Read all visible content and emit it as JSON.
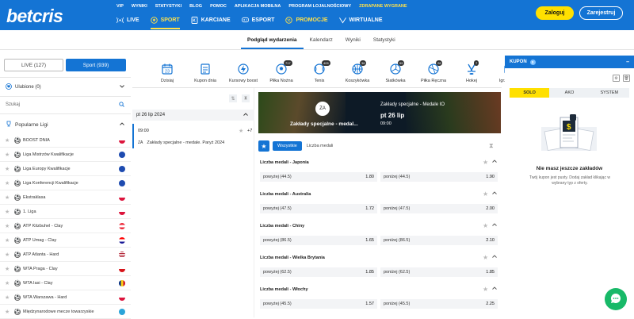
{
  "brand": {
    "logo": "betcris"
  },
  "top_links": [
    "VIP",
    "WYNIKI",
    "STATYSTYKI",
    "BLOG",
    "POMOC",
    "APLIKACJA MOBILNA",
    "PROGRAM LOJALNOŚCIOWY",
    "ZDRAPANE WYGRANE"
  ],
  "main_nav": [
    {
      "label": "LIVE",
      "icon": "live-icon"
    },
    {
      "label": "SPORT",
      "icon": "sport-icon"
    },
    {
      "label": "KARCIANE",
      "icon": "cards-icon"
    },
    {
      "label": "ESPORT",
      "icon": "esport-icon"
    },
    {
      "label": "PROMOCJE",
      "icon": "promo-icon"
    },
    {
      "label": "WIRTUALNE",
      "icon": "virtual-icon"
    }
  ],
  "auth": {
    "login": "Zaloguj",
    "register": "Zarejestruj"
  },
  "sub_tabs": [
    "Podgląd wydarzenia",
    "Kalendarz",
    "Wyniki",
    "Statystyki"
  ],
  "left": {
    "live_btn": "LIVE (127)",
    "sport_btn": "Sport (939)",
    "favorites": "Ulubione (0)",
    "search_placeholder": "Szukaj",
    "popular": "Popularne Ligi",
    "leagues": [
      {
        "name": "BOOST DNIA",
        "flag": "pl"
      },
      {
        "name": "Liga Mistrzów Kwalifikacje",
        "flag": "eu"
      },
      {
        "name": "Liga Europy Kwalifikacje",
        "flag": "eu"
      },
      {
        "name": "Liga Konferencji Kwalifikacje",
        "flag": "eu"
      },
      {
        "name": "Ekstraklasa",
        "flag": "pl"
      },
      {
        "name": "1. Liga",
        "flag": "pl"
      },
      {
        "name": "ATP Kitzbuhel - Clay",
        "flag": "at"
      },
      {
        "name": "ATP Umag - Clay",
        "flag": "hr"
      },
      {
        "name": "ATP Atlanta - Hard",
        "flag": "us"
      },
      {
        "name": "WTA Praga - Clay",
        "flag": "cz"
      },
      {
        "name": "WTA Iasi - Clay",
        "flag": "ro"
      },
      {
        "name": "WTA Warszawa - Hard",
        "flag": "pl"
      },
      {
        "name": "Międzynarodowe mecze towarzyskie",
        "flag": "world"
      }
    ]
  },
  "sports": [
    {
      "label": "Dzisiaj",
      "icon": "calendar-icon"
    },
    {
      "label": "Kupon dnia",
      "icon": "coupon-icon"
    },
    {
      "label": "Kursowy boost",
      "icon": "boost-icon"
    },
    {
      "label": "Piłka Nożna",
      "icon": "football-icon",
      "count": "717"
    },
    {
      "label": "Tenis",
      "icon": "tennis-icon",
      "count": "405"
    },
    {
      "label": "Koszykówka",
      "icon": "basketball-icon",
      "count": "36"
    },
    {
      "label": "Siatkówka",
      "icon": "volleyball-icon",
      "count": "59"
    },
    {
      "label": "Piłka Ręczna",
      "icon": "handball-icon",
      "count": "28"
    },
    {
      "label": "Hokej",
      "icon": "hockey-icon",
      "count": "7"
    },
    {
      "label": "Igrzyska O",
      "icon": "olympics-icon"
    }
  ],
  "events": {
    "date": "pt 26 lip 2024",
    "time": "09:00",
    "plus": "+7",
    "prefix": "ZA",
    "title": "Zakłady specjalne - medale. Paryż 2024"
  },
  "banner": {
    "badge": "ZA",
    "left_title": "Zakłady specjalne - medal...",
    "title": "Zakłady specjalne - Medale IO",
    "date": "pt 26 lip",
    "time": "09:00"
  },
  "filters": {
    "all": "Wszystkie",
    "medals": "Liczba medali"
  },
  "markets": [
    {
      "title": "Liczba medali - Japonia",
      "over_label": "powyżej (44.5)",
      "over": "1.80",
      "under_label": "poniżej (44.5)",
      "under": "1.90"
    },
    {
      "title": "Liczba medali - Australia",
      "over_label": "powyżej (47.5)",
      "over": "1.72",
      "under_label": "poniżej (47.5)",
      "under": "2.00"
    },
    {
      "title": "Liczba medali - Chiny",
      "over_label": "powyżej (86.5)",
      "over": "1.65",
      "under_label": "poniżej (86.5)",
      "under": "2.10"
    },
    {
      "title": "Liczba medali - Wielka Brytania",
      "over_label": "powyżej (62.5)",
      "over": "1.85",
      "under_label": "poniżej (62.5)",
      "under": "1.85"
    },
    {
      "title": "Liczba medali - Włochy",
      "over_label": "powyżej (45.5)",
      "over": "1.57",
      "under_label": "poniżej (45.5)",
      "under": "2.25"
    }
  ],
  "coupon": {
    "title": "KUPON",
    "count": "0",
    "tabs": [
      "SOLO",
      "AKO",
      "SYSTEM"
    ],
    "empty_title": "Nie masz jeszcze zakładów",
    "empty_text": "Twój kupon jest pusty. Dodaj zakład klikając w wybrany typ z oferty."
  },
  "colors": {
    "brand_blue": "#1474d4",
    "accent_yellow": "#ffe000",
    "chat_green": "#18b968"
  }
}
